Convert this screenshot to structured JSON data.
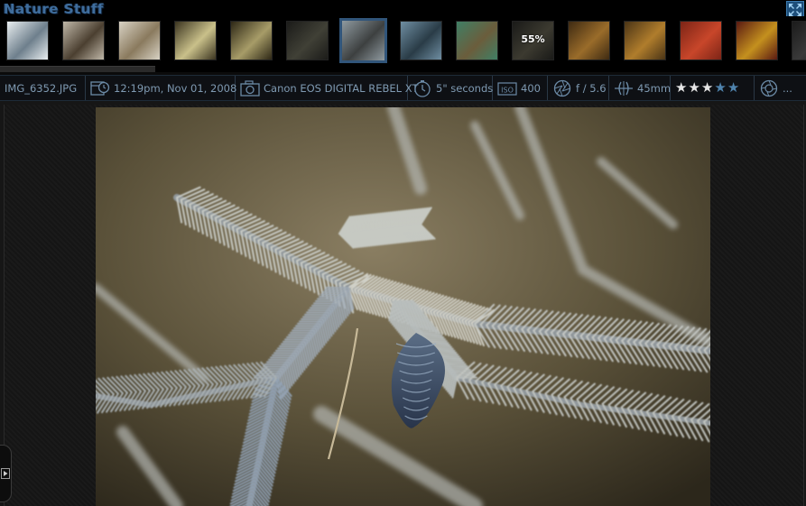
{
  "album": {
    "title": "Nature Stuff"
  },
  "filmstrip": {
    "thumbnails": [
      {
        "id": "t1",
        "colors": [
          "#e9eef0",
          "#6e7f8c"
        ]
      },
      {
        "id": "t2",
        "colors": [
          "#bfb7a8",
          "#4b3f30"
        ]
      },
      {
        "id": "t3",
        "colors": [
          "#d8d2c4",
          "#8a7a5e"
        ]
      },
      {
        "id": "t4",
        "colors": [
          "#3b3420",
          "#c9c08a"
        ]
      },
      {
        "id": "t5",
        "colors": [
          "#2d2716",
          "#a79c68"
        ]
      },
      {
        "id": "t6",
        "colors": [
          "#1b1b19",
          "#404036"
        ]
      },
      {
        "id": "t7",
        "colors": [
          "#8f9aa0",
          "#3d4040"
        ],
        "selected": true
      },
      {
        "id": "t8",
        "colors": [
          "#6f8ea2",
          "#2a3c47"
        ]
      },
      {
        "id": "t9",
        "colors": [
          "#3f7f65",
          "#6b5d3c"
        ]
      },
      {
        "id": "t10",
        "colors": [
          "#1a1a18",
          "#3c3a30"
        ],
        "label": "55%"
      },
      {
        "id": "t11",
        "colors": [
          "#3e2a12",
          "#9a6c2a"
        ]
      },
      {
        "id": "t12",
        "colors": [
          "#4a3416",
          "#b07d2c"
        ]
      },
      {
        "id": "t13",
        "colors": [
          "#7c2416",
          "#c8462a"
        ]
      },
      {
        "id": "t14",
        "colors": [
          "#5a1a12",
          "#c4901e"
        ]
      },
      {
        "id": "t15",
        "colors": [
          "#1b1b1b",
          "#3a3a3a"
        ]
      }
    ]
  },
  "info": {
    "filename": "IMG_6352.JPG",
    "datetime": "12:19pm, Nov 01, 2008",
    "camera": "Canon EOS DIGITAL REBEL XT",
    "exposure": "5\" seconds",
    "iso": "400",
    "aperture": "f / 5.6",
    "focal_length": "45mm",
    "rating": 3,
    "rating_max": 5,
    "more": "..."
  },
  "colors": {
    "accent": "#3f6d9c",
    "label": "#7f9ab2",
    "star_on": "#e6e6e6",
    "star_off": "#4f83ad"
  },
  "icons": {
    "date": "calendar-clock-icon",
    "camera": "camera-icon",
    "exposure": "timer-icon",
    "iso": "iso-icon",
    "aperture": "aperture-icon",
    "focal": "focal-length-icon",
    "more": "lens-icon",
    "fullscreen": "expand-icon",
    "side": "play-arrow-icon"
  }
}
